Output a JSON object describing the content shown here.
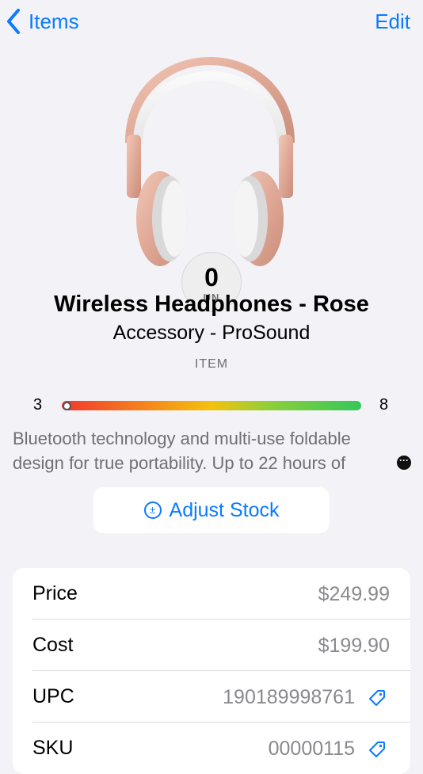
{
  "navbar": {
    "back_label": "Items",
    "edit_label": "Edit"
  },
  "item": {
    "quantity": "0",
    "unit": "UN",
    "name": "Wireless Headphones - Rose",
    "category": "Accessory - ProSound",
    "type": "ITEM",
    "stock_min": "3",
    "stock_max": "8",
    "stock_level_fraction": 0.0,
    "description": "Bluetooth technology and multi-use foldable design for true portability.  Up to 22 hours of"
  },
  "actions": {
    "adjust_stock_label": "Adjust Stock"
  },
  "details": {
    "rows": [
      {
        "label": "Price",
        "value": "$249.99"
      },
      {
        "label": "Cost",
        "value": "$199.90"
      },
      {
        "label": "UPC",
        "value": "190189998761"
      },
      {
        "label": "SKU",
        "value": "00000115"
      }
    ]
  },
  "colors": {
    "accent": "#0a7aff",
    "background": "#f2f2f7"
  },
  "icons": [
    "chevron-left-icon",
    "plus-minus-circle-icon",
    "tag-icon",
    "ellipsis-bubble-icon"
  ]
}
